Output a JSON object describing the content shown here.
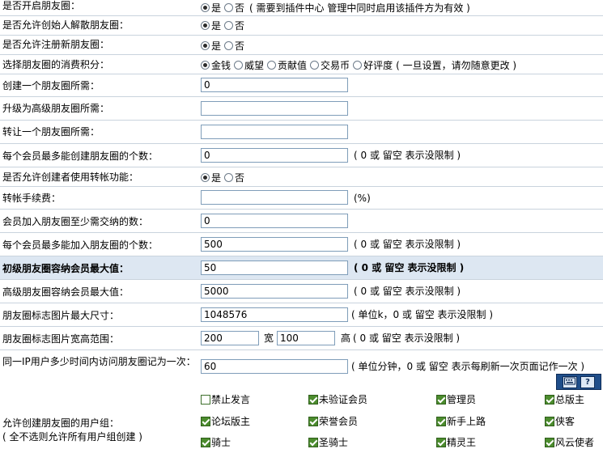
{
  "rows": {
    "enable": {
      "label": "是否开启朋友圈：",
      "yes": "是",
      "no": "否",
      "note": "( 需要到插件中心 管理中同时启用该插件方为有效 )"
    },
    "allow_dissolve": {
      "label": "是否允许创始人解散朋友圈：",
      "yes": "是",
      "no": "否"
    },
    "allow_register": {
      "label": "是否允许注册新朋友圈：",
      "yes": "是",
      "no": "否"
    },
    "credit": {
      "label": "选择朋友圈的消费积分：",
      "options": [
        "金钱",
        "威望",
        "贡献值",
        "交易币",
        "好评度"
      ],
      "note": "( 一旦设置，请勿随意更改 )"
    },
    "create_cost": {
      "label": "创建一个朋友圈所需：",
      "value": "0"
    },
    "upgrade_cost": {
      "label": "升级为高级朋友圈所需：",
      "value": ""
    },
    "transfer_cost": {
      "label": "转让一个朋友圈所需：",
      "value": ""
    },
    "max_create": {
      "label": "每个会员最多能创建朋友圈的个数：",
      "value": "0",
      "note": "( 0 或 留空 表示没限制 )"
    },
    "allow_transfer": {
      "label": "是否允许创建者使用转帐功能：",
      "yes": "是",
      "no": "否"
    },
    "transfer_fee": {
      "label": "转帐手续费：",
      "value": "",
      "note": "(%)"
    },
    "join_fee": {
      "label": "会员加入朋友圈至少需交纳的数：",
      "value": "0"
    },
    "max_join": {
      "label": "每个会员最多能加入朋友圈的个数：",
      "value": "500",
      "note": "( 0 或 留空 表示没限制 )"
    },
    "basic_max": {
      "label": "初级朋友圈容纳会员最大值：",
      "value": "50",
      "note": "( 0 或 留空 表示没限制 )"
    },
    "senior_max": {
      "label": "高级朋友圈容纳会员最大值：",
      "value": "5000",
      "note": "( 0 或 留空 表示没限制 )"
    },
    "logo_size": {
      "label": "朋友圈标志图片最大尺寸：",
      "value": "1048576",
      "note": "( 单位k，0 或 留空 表示没限制 )"
    },
    "logo_dims": {
      "label": "朋友圈标志图片宽高范围：",
      "width": "200",
      "width_label": "宽",
      "height": "100",
      "height_label": "高",
      "note": "( 0 或 留空 表示没限制 )"
    },
    "ip_interval": {
      "label": "同一IP用户多少时间内访问朋友圈记为一次：",
      "value": "60",
      "note": "( 单位分钟，0 或 留空 表示每刷新一次页面记作一次 )"
    },
    "groups": {
      "label": "允许创建朋友圈的用户组：",
      "sublabel": "( 全不选则允许所有用户组创建 )",
      "items": [
        {
          "name": "禁止发言",
          "checked": false
        },
        {
          "name": "未验证会员",
          "checked": true
        },
        {
          "name": "管理员",
          "checked": true
        },
        {
          "name": "总版主",
          "checked": true
        },
        {
          "name": "论坛版主",
          "checked": true
        },
        {
          "name": "荣誉会员",
          "checked": true
        },
        {
          "name": "新手上路",
          "checked": true
        },
        {
          "name": "侠客",
          "checked": true
        },
        {
          "name": "骑士",
          "checked": true
        },
        {
          "name": "圣骑士",
          "checked": true
        },
        {
          "name": "精灵王",
          "checked": true
        },
        {
          "name": "风云使者",
          "checked": true
        }
      ]
    }
  },
  "toolbar": {
    "icons": [
      "keyboard-icon",
      "help-icon"
    ],
    "help_glyph": "?"
  }
}
